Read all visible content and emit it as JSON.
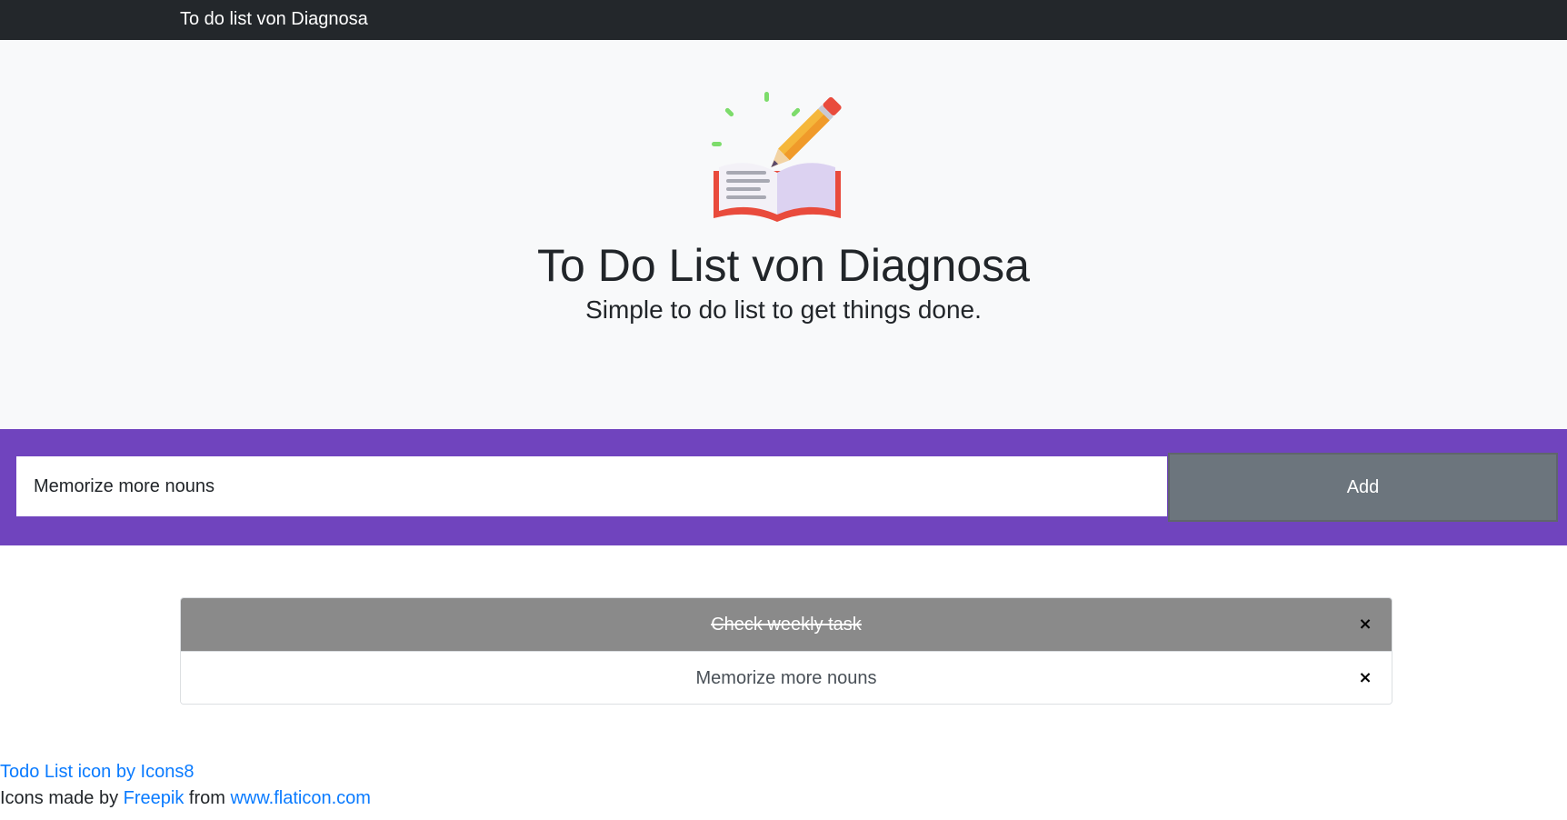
{
  "navbar": {
    "brand": "To do list von Diagnosa"
  },
  "hero": {
    "icon": "open-book-pencil-icon",
    "title": "To Do List von Diagnosa",
    "subtitle": "Simple to do list to get things done."
  },
  "form": {
    "input_value": "Memorize more nouns",
    "add_label": "Add"
  },
  "todos": [
    {
      "text": "Check weekly task",
      "done": true,
      "remove_label": "×"
    },
    {
      "text": "Memorize more nouns",
      "done": false,
      "remove_label": "×"
    }
  ],
  "footer": {
    "line1_link": "Todo List icon by Icons8",
    "line2_prefix": "Icons made by ",
    "line2_author": "Freepik",
    "line2_middle": " from ",
    "line2_site": "www.flaticon.com"
  },
  "colors": {
    "navbar": "#23272b",
    "hero_background": "#f8f9fa",
    "input_band": "#7044be",
    "add_button": "#6c757d",
    "done_item": "#8a8a8a",
    "link": "#0a7bff"
  }
}
